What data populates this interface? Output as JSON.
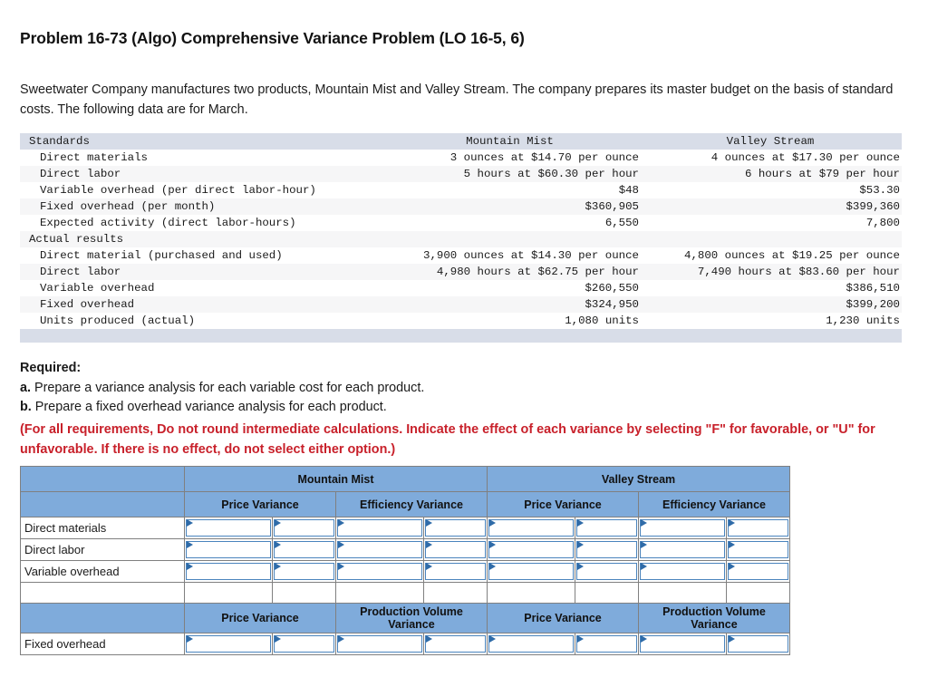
{
  "title": "Problem 16-73 (Algo) Comprehensive Variance Problem (LO 16-5, 6)",
  "intro": "Sweetwater Company manufactures two products, Mountain Mist and Valley Stream. The company prepares its master budget on the basis of standard costs. The following data are for March.",
  "data_table": {
    "columns": [
      "",
      "Mountain Mist",
      "Valley Stream"
    ],
    "sections": [
      {
        "header": "Standards",
        "rows": [
          {
            "label": "Direct materials",
            "mm": "3 ounces at $14.70 per ounce",
            "vs": "4 ounces at $17.30 per ounce"
          },
          {
            "label": "Direct labor",
            "mm": "5 hours at $60.30 per hour",
            "vs": "6 hours at $79 per hour"
          },
          {
            "label": "Variable overhead (per direct labor-hour)",
            "mm": "$48",
            "vs": "$53.30"
          },
          {
            "label": "Fixed overhead (per month)",
            "mm": "$360,905",
            "vs": "$399,360"
          },
          {
            "label": "Expected activity (direct labor-hours)",
            "mm": "6,550",
            "vs": "7,800"
          }
        ]
      },
      {
        "header": "Actual results",
        "rows": [
          {
            "label": "Direct material (purchased and used)",
            "mm": "3,900 ounces at $14.30 per ounce",
            "vs": "4,800 ounces at $19.25 per ounce"
          },
          {
            "label": "Direct labor",
            "mm": "4,980 hours at $62.75 per hour",
            "vs": "7,490 hours at $83.60 per hour"
          },
          {
            "label": "Variable overhead",
            "mm": "$260,550",
            "vs": "$386,510"
          },
          {
            "label": "Fixed overhead",
            "mm": "$324,950",
            "vs": "$399,200"
          },
          {
            "label": "Units produced (actual)",
            "mm": "1,080 units",
            "vs": "1,230 units"
          }
        ]
      }
    ]
  },
  "required": {
    "heading": "Required:",
    "item_a_marker": "a.",
    "item_a": " Prepare a variance analysis for each variable cost for each product.",
    "item_b_marker": "b.",
    "item_b": " Prepare a fixed overhead variance analysis for each product.",
    "note": "(For all requirements, Do not round intermediate calculations. Indicate the effect of each variance by selecting \"F\" for favorable, or \"U\" for unfavorable. If there is no effect, do not select either option.)"
  },
  "answer_table": {
    "product_headers": [
      "Mountain Mist",
      "Valley Stream"
    ],
    "variance_headers_variable": [
      "Price Variance",
      "Efficiency Variance",
      "Price Variance",
      "Efficiency Variance"
    ],
    "variance_headers_fixed": [
      "Price Variance",
      "Production Volume Variance",
      "Price Variance",
      "Production Volume Variance"
    ],
    "variable_rows": [
      "Direct materials",
      "Direct labor",
      "Variable overhead"
    ],
    "fixed_rows": [
      "Fixed overhead"
    ],
    "empty_value": ""
  },
  "colors": {
    "header_blue": "#7fabdb",
    "data_header_gray": "#d8dde8",
    "stripe_gray": "#f6f6f7",
    "note_red": "#c8202a",
    "input_border_blue": "#4a84bd",
    "input_marker_blue": "#2f6ba8",
    "grid_border": "#808080"
  }
}
